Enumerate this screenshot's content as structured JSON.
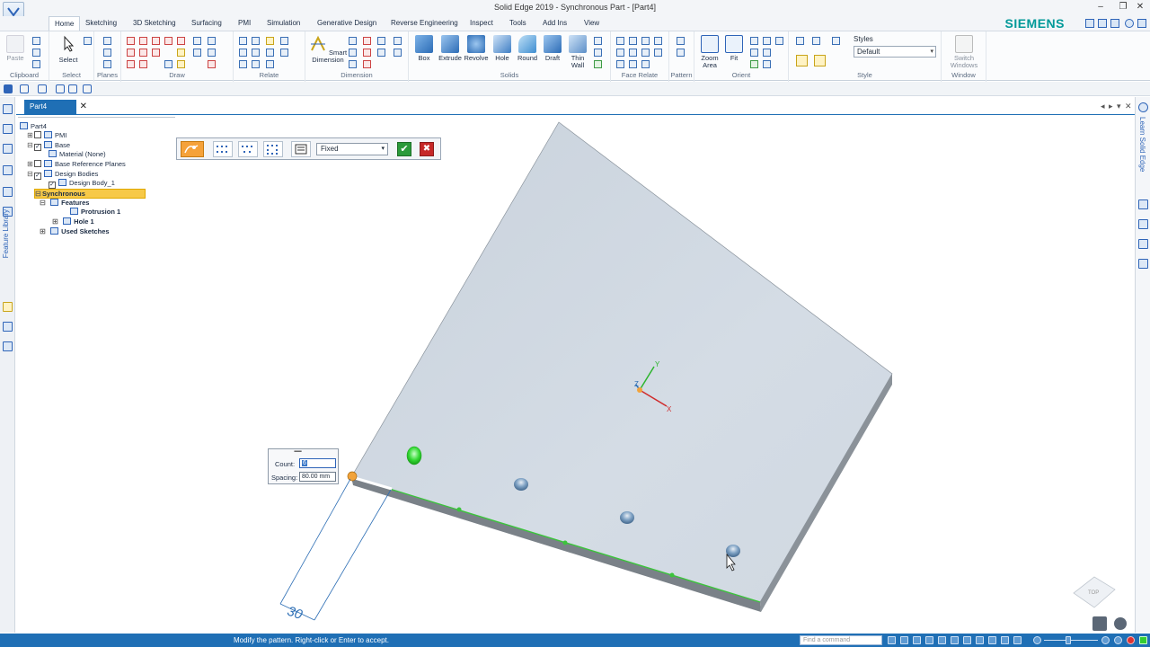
{
  "window": {
    "title": "Solid Edge 2019 - Synchronous Part - [Part4]",
    "brand": "SIEMENS"
  },
  "ribbon_tabs": [
    "Home",
    "Sketching",
    "3D Sketching",
    "Surfacing",
    "PMI",
    "Simulation",
    "Generative Design",
    "Reverse Engineering",
    "Inspect",
    "Tools",
    "Add Ins",
    "View"
  ],
  "ribbon": {
    "groups": {
      "clipboard": "Clipboard",
      "select": "Select",
      "planes": "Planes",
      "draw": "Draw",
      "relate": "Relate",
      "dimension": "Dimension",
      "solids": "Solids",
      "face_relate": "Face Relate",
      "pattern": "Pattern",
      "orient": "Orient",
      "style": "Style",
      "window": "Window"
    },
    "buttons": {
      "paste": "Paste",
      "select": "Select",
      "smart_dimension_1": "Smart",
      "smart_dimension_2": "Dimension",
      "box": "Box",
      "extrude": "Extrude",
      "revolve": "Revolve",
      "hole": "Hole",
      "round": "Round",
      "draft": "Draft",
      "thin_wall_1": "Thin",
      "thin_wall_2": "Wall",
      "zoom_area_1": "Zoom",
      "zoom_area_2": "Area",
      "fit": "Fit",
      "switch_windows_1": "Switch",
      "switch_windows_2": "Windows",
      "styles": "Styles"
    },
    "style_value": "Default"
  },
  "document": {
    "tab": "Part4"
  },
  "tree": {
    "root": "Part4",
    "pmi": "PMI",
    "base": "Base",
    "material": "Material (None)",
    "base_ref_planes": "Base Reference Planes",
    "design_bodies": "Design Bodies",
    "design_body_1": "Design Body_1",
    "synchronous": "Synchronous",
    "features": "Features",
    "protrusion": "Protrusion 1",
    "hole": "Hole 1",
    "used_sketches": "Used Sketches"
  },
  "command_bar": {
    "mode_value": "Fixed",
    "ok": "✔",
    "cancel": "✖"
  },
  "pattern_box": {
    "count_label": "Count:",
    "count_value": "6",
    "spacing_label": "Spacing:",
    "spacing_value": "80.00 mm"
  },
  "viewport": {
    "dimension_value": "30",
    "axis_x": "X",
    "axis_y": "Y",
    "axis_z": "Z",
    "view_cube": "TOP",
    "left_strip_label": "Feature Library",
    "right_strip_label": "Learn Solid Edge"
  },
  "status": {
    "prompt": "Modify the pattern.  Right-click or Enter to accept.",
    "find_placeholder": "Find a command"
  },
  "colors": {
    "accent": "#1f6fb5",
    "brand": "#009999",
    "plate_top": "#d2dae3",
    "plate_edge": "#7f868e",
    "selected_edge": "#3cc43c",
    "highlight": "#f7c948"
  }
}
